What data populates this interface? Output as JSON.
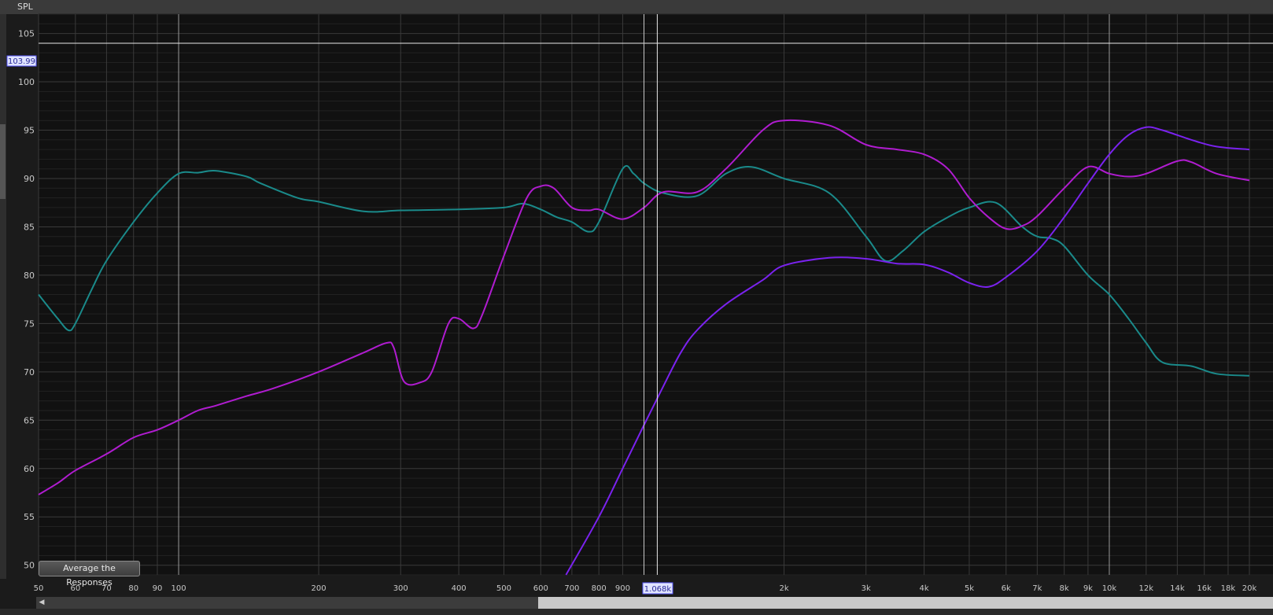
{
  "header": {
    "title": "SPL"
  },
  "cursor": {
    "y_value": "103.99",
    "x_value": "1.068k"
  },
  "buttons": {
    "average": "Average the Responses"
  },
  "chart_data": {
    "type": "line",
    "title": "",
    "ylabel": "SPL",
    "xlabel": "",
    "x_scale": "log",
    "xlim": [
      50,
      20000
    ],
    "ylim": [
      49,
      107
    ],
    "grid": true,
    "y_ticks": [
      50,
      55,
      60,
      65,
      70,
      75,
      80,
      85,
      90,
      95,
      100,
      105
    ],
    "x_ticks": [
      {
        "v": 50,
        "l": "50"
      },
      {
        "v": 60,
        "l": "60"
      },
      {
        "v": 70,
        "l": "70"
      },
      {
        "v": 80,
        "l": "80"
      },
      {
        "v": 90,
        "l": "90"
      },
      {
        "v": 100,
        "l": "100"
      },
      {
        "v": 200,
        "l": "200"
      },
      {
        "v": 300,
        "l": "300"
      },
      {
        "v": 400,
        "l": "400"
      },
      {
        "v": 500,
        "l": "500"
      },
      {
        "v": 600,
        "l": "600"
      },
      {
        "v": 700,
        "l": "700"
      },
      {
        "v": 800,
        "l": "800"
      },
      {
        "v": 900,
        "l": "900"
      },
      {
        "v": 2000,
        "l": "2k"
      },
      {
        "v": 3000,
        "l": "3k"
      },
      {
        "v": 4000,
        "l": "4k"
      },
      {
        "v": 5000,
        "l": "5k"
      },
      {
        "v": 6000,
        "l": "6k"
      },
      {
        "v": 7000,
        "l": "7k"
      },
      {
        "v": 8000,
        "l": "8k"
      },
      {
        "v": 9000,
        "l": "9k"
      },
      {
        "v": 10000,
        "l": "10k"
      },
      {
        "v": 12000,
        "l": "12k"
      },
      {
        "v": 14000,
        "l": "14k"
      },
      {
        "v": 16000,
        "l": "16k"
      },
      {
        "v": 18000,
        "l": "18k"
      },
      {
        "v": 20000,
        "l": "20k"
      }
    ],
    "cursor_lines": {
      "x": 1068,
      "y": 103.99,
      "x_ref": 1000
    },
    "series": [
      {
        "color": "#1a8a8a",
        "points": [
          [
            50,
            78
          ],
          [
            55,
            75.5
          ],
          [
            58,
            74.3
          ],
          [
            60,
            75
          ],
          [
            65,
            78.5
          ],
          [
            70,
            81.5
          ],
          [
            80,
            85.5
          ],
          [
            90,
            88.5
          ],
          [
            100,
            90.5
          ],
          [
            110,
            90.6
          ],
          [
            120,
            90.8
          ],
          [
            140,
            90.2
          ],
          [
            150,
            89.5
          ],
          [
            180,
            88
          ],
          [
            200,
            87.6
          ],
          [
            250,
            86.6
          ],
          [
            300,
            86.7
          ],
          [
            400,
            86.8
          ],
          [
            500,
            87
          ],
          [
            550,
            87.4
          ],
          [
            600,
            86.8
          ],
          [
            650,
            86
          ],
          [
            700,
            85.5
          ],
          [
            760,
            84.5
          ],
          [
            800,
            85.5
          ],
          [
            900,
            91
          ],
          [
            950,
            90.5
          ],
          [
            1000,
            89.5
          ],
          [
            1100,
            88.5
          ],
          [
            1300,
            88.2
          ],
          [
            1500,
            90.5
          ],
          [
            1700,
            91.2
          ],
          [
            2000,
            90
          ],
          [
            2500,
            88.5
          ],
          [
            3000,
            84
          ],
          [
            3300,
            81.5
          ],
          [
            3600,
            82.5
          ],
          [
            4000,
            84.5
          ],
          [
            4500,
            86
          ],
          [
            5000,
            87
          ],
          [
            5700,
            87.5
          ],
          [
            6500,
            85
          ],
          [
            7000,
            84
          ],
          [
            7500,
            83.8
          ],
          [
            8000,
            83
          ],
          [
            9000,
            80
          ],
          [
            10000,
            78
          ],
          [
            11000,
            75.5
          ],
          [
            12000,
            73
          ],
          [
            13000,
            71
          ],
          [
            15000,
            70.6
          ],
          [
            17000,
            69.8
          ],
          [
            20000,
            69.6
          ]
        ]
      },
      {
        "color": "#b01cd0",
        "points": [
          [
            50,
            57.3
          ],
          [
            55,
            58.5
          ],
          [
            60,
            59.8
          ],
          [
            70,
            61.5
          ],
          [
            80,
            63.2
          ],
          [
            90,
            64
          ],
          [
            100,
            65
          ],
          [
            110,
            66
          ],
          [
            120,
            66.5
          ],
          [
            140,
            67.5
          ],
          [
            160,
            68.3
          ],
          [
            200,
            70
          ],
          [
            250,
            72
          ],
          [
            280,
            73
          ],
          [
            290,
            72.5
          ],
          [
            305,
            69
          ],
          [
            330,
            68.9
          ],
          [
            350,
            70
          ],
          [
            380,
            75
          ],
          [
            400,
            75.5
          ],
          [
            430,
            74.5
          ],
          [
            450,
            76
          ],
          [
            500,
            82
          ],
          [
            560,
            88
          ],
          [
            600,
            89.2
          ],
          [
            640,
            89
          ],
          [
            700,
            87
          ],
          [
            760,
            86.7
          ],
          [
            800,
            86.8
          ],
          [
            900,
            85.8
          ],
          [
            1000,
            87
          ],
          [
            1100,
            88.6
          ],
          [
            1300,
            88.6
          ],
          [
            1500,
            91
          ],
          [
            1800,
            95
          ],
          [
            2000,
            96
          ],
          [
            2500,
            95.5
          ],
          [
            3000,
            93.5
          ],
          [
            3500,
            93
          ],
          [
            4000,
            92.5
          ],
          [
            4500,
            91
          ],
          [
            5000,
            88
          ],
          [
            5500,
            86
          ],
          [
            6000,
            84.8
          ],
          [
            6500,
            85.1
          ],
          [
            7000,
            86.1
          ],
          [
            8000,
            89
          ],
          [
            9000,
            91.2
          ],
          [
            10000,
            90.5
          ],
          [
            11000,
            90.2
          ],
          [
            12000,
            90.5
          ],
          [
            14000,
            91.8
          ],
          [
            15000,
            91.7
          ],
          [
            17000,
            90.5
          ],
          [
            20000,
            89.8
          ]
        ]
      },
      {
        "color": "#7a22ee",
        "points": [
          [
            680,
            49
          ],
          [
            800,
            55
          ],
          [
            900,
            60
          ],
          [
            1000,
            64.5
          ],
          [
            1100,
            68.5
          ],
          [
            1200,
            72
          ],
          [
            1300,
            74.3
          ],
          [
            1500,
            77
          ],
          [
            1800,
            79.5
          ],
          [
            2000,
            81
          ],
          [
            2500,
            81.8
          ],
          [
            3000,
            81.7
          ],
          [
            3500,
            81.2
          ],
          [
            4000,
            81.1
          ],
          [
            4500,
            80.3
          ],
          [
            5000,
            79.2
          ],
          [
            5500,
            78.8
          ],
          [
            6000,
            79.8
          ],
          [
            7000,
            82.5
          ],
          [
            8000,
            86
          ],
          [
            9000,
            89.5
          ],
          [
            10000,
            92.5
          ],
          [
            11000,
            94.5
          ],
          [
            12000,
            95.3
          ],
          [
            13000,
            95
          ],
          [
            15000,
            94
          ],
          [
            17000,
            93.3
          ],
          [
            20000,
            93
          ]
        ]
      }
    ]
  }
}
